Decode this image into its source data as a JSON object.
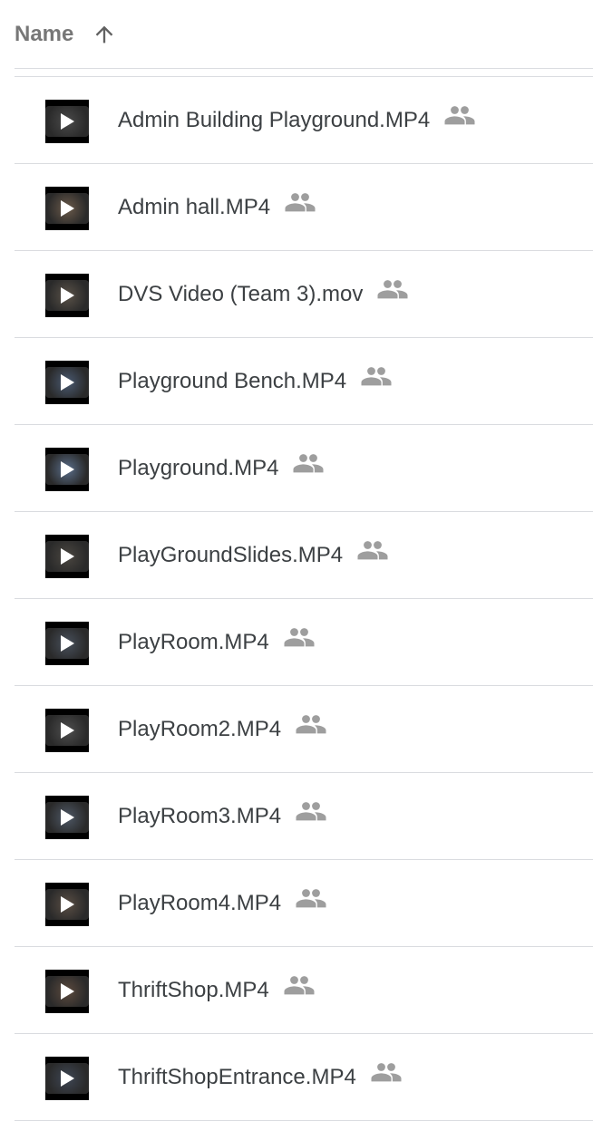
{
  "header": {
    "sort_label": "Name",
    "sort_icon": "arrow-upward-icon"
  },
  "files": [
    {
      "name": "Admin Building Playground.MP4",
      "type_icon": "video-play-icon",
      "status_icon": "shared-people-icon",
      "thumb_color": "#4a4a4a"
    },
    {
      "name": "Admin hall.MP4",
      "type_icon": "video-play-icon",
      "status_icon": "shared-people-icon",
      "thumb_color": "#6b5a4a"
    },
    {
      "name": "DVS Video (Team 3).mov",
      "type_icon": "video-play-icon",
      "status_icon": "shared-people-icon",
      "thumb_color": "#5a5248"
    },
    {
      "name": "Playground Bench.MP4",
      "type_icon": "video-play-icon",
      "status_icon": "shared-people-icon",
      "thumb_color": "#4a5a72"
    },
    {
      "name": "Playground.MP4",
      "type_icon": "video-play-icon",
      "status_icon": "shared-people-icon",
      "thumb_color": "#5a6e8a"
    },
    {
      "name": "PlayGroundSlides.MP4",
      "type_icon": "video-play-icon",
      "status_icon": "shared-people-icon",
      "thumb_color": "#4a4640"
    },
    {
      "name": "PlayRoom.MP4",
      "type_icon": "video-play-icon",
      "status_icon": "shared-people-icon",
      "thumb_color": "#48505c"
    },
    {
      "name": "PlayRoom2.MP4",
      "type_icon": "video-play-icon",
      "status_icon": "shared-people-icon",
      "thumb_color": "#4e4e4e"
    },
    {
      "name": "PlayRoom3.MP4",
      "type_icon": "video-play-icon",
      "status_icon": "shared-people-icon",
      "thumb_color": "#4e5866"
    },
    {
      "name": "PlayRoom4.MP4",
      "type_icon": "video-play-icon",
      "status_icon": "shared-people-icon",
      "thumb_color": "#5a4e44"
    },
    {
      "name": "ThriftShop.MP4",
      "type_icon": "video-play-icon",
      "status_icon": "shared-people-icon",
      "thumb_color": "#5c4a3e"
    },
    {
      "name": "ThriftShopEntrance.MP4",
      "type_icon": "video-play-icon",
      "status_icon": "shared-people-icon",
      "thumb_color": "#3e4654"
    }
  ],
  "colors": {
    "text": "#3c4043",
    "header_text": "#777777",
    "icon": "#9e9e9e",
    "divider": "#dadce0"
  }
}
